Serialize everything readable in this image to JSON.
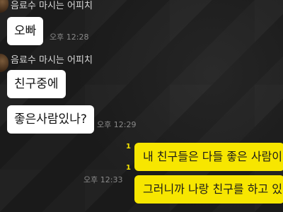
{
  "chat": {
    "messages": [
      {
        "sender": "음료수 마시는 어피치",
        "text": "오빠",
        "time": "오후 12:28"
      },
      {
        "sender": "음료수 마시는 어피치",
        "text": "친구중에",
        "time": ""
      },
      {
        "sender": "",
        "text": "좋은사람있나?",
        "time": "오후 12:29"
      },
      {
        "sender": "",
        "text": "내 친구들은 다들 좋은 사람이",
        "time": "",
        "unread": "1"
      },
      {
        "sender": "",
        "text": "그러니까 나랑 친구를 하고 있",
        "time": "오후 12:33",
        "unread": "1"
      }
    ]
  },
  "colors": {
    "background": "#1b1b1b",
    "incoming_bubble": "#ffffff",
    "outgoing_bubble": "#f7e600",
    "unread": "#f7e600"
  }
}
